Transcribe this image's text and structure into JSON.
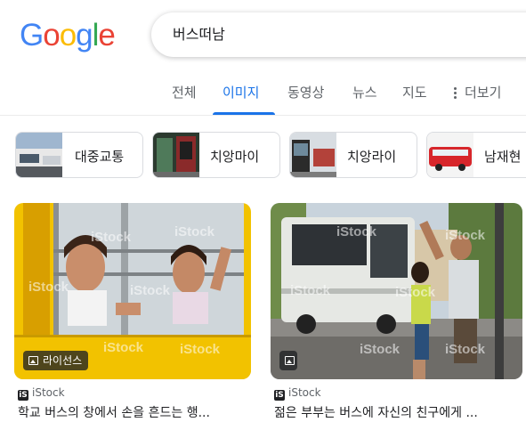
{
  "logo": {
    "text": "Google",
    "letters": [
      "G",
      "o",
      "o",
      "g",
      "l",
      "e"
    ],
    "colors": {
      "blue": "#4285f4",
      "red": "#ea4335",
      "yellow": "#fbbc05",
      "green": "#34a853"
    }
  },
  "search": {
    "query": "버스떠남"
  },
  "tabs": [
    {
      "label": "전체",
      "active": false
    },
    {
      "label": "이미지",
      "active": true
    },
    {
      "label": "동영상",
      "active": false
    },
    {
      "label": "뉴스",
      "active": false
    },
    {
      "label": "지도",
      "active": false
    },
    {
      "label": "더보기",
      "active": false,
      "icon": "more-vert-icon"
    }
  ],
  "accent_color": "#1a73e8",
  "chips": [
    {
      "label": "대중교통",
      "thumb": "bus-station-thumbnail"
    },
    {
      "label": "치앙마이",
      "thumb": "bus-door-thumbnail"
    },
    {
      "label": "치앙라이",
      "thumb": "bus-terminal-thumbnail"
    },
    {
      "label": "남재현",
      "thumb": "red-bus-thumbnail"
    }
  ],
  "results": [
    {
      "image": "school-bus-children-waving-image",
      "badge": "라이선스",
      "watermark": "iStock",
      "source": "iStock",
      "title": "학교 버스의 창에서 손을 흔드는 행..."
    },
    {
      "image": "couple-waving-at-bus-image",
      "badge": "",
      "watermark": "iStock",
      "source": "iStock",
      "title": "젊은 부부는 버스에 자신의 친구에게 ..."
    }
  ]
}
